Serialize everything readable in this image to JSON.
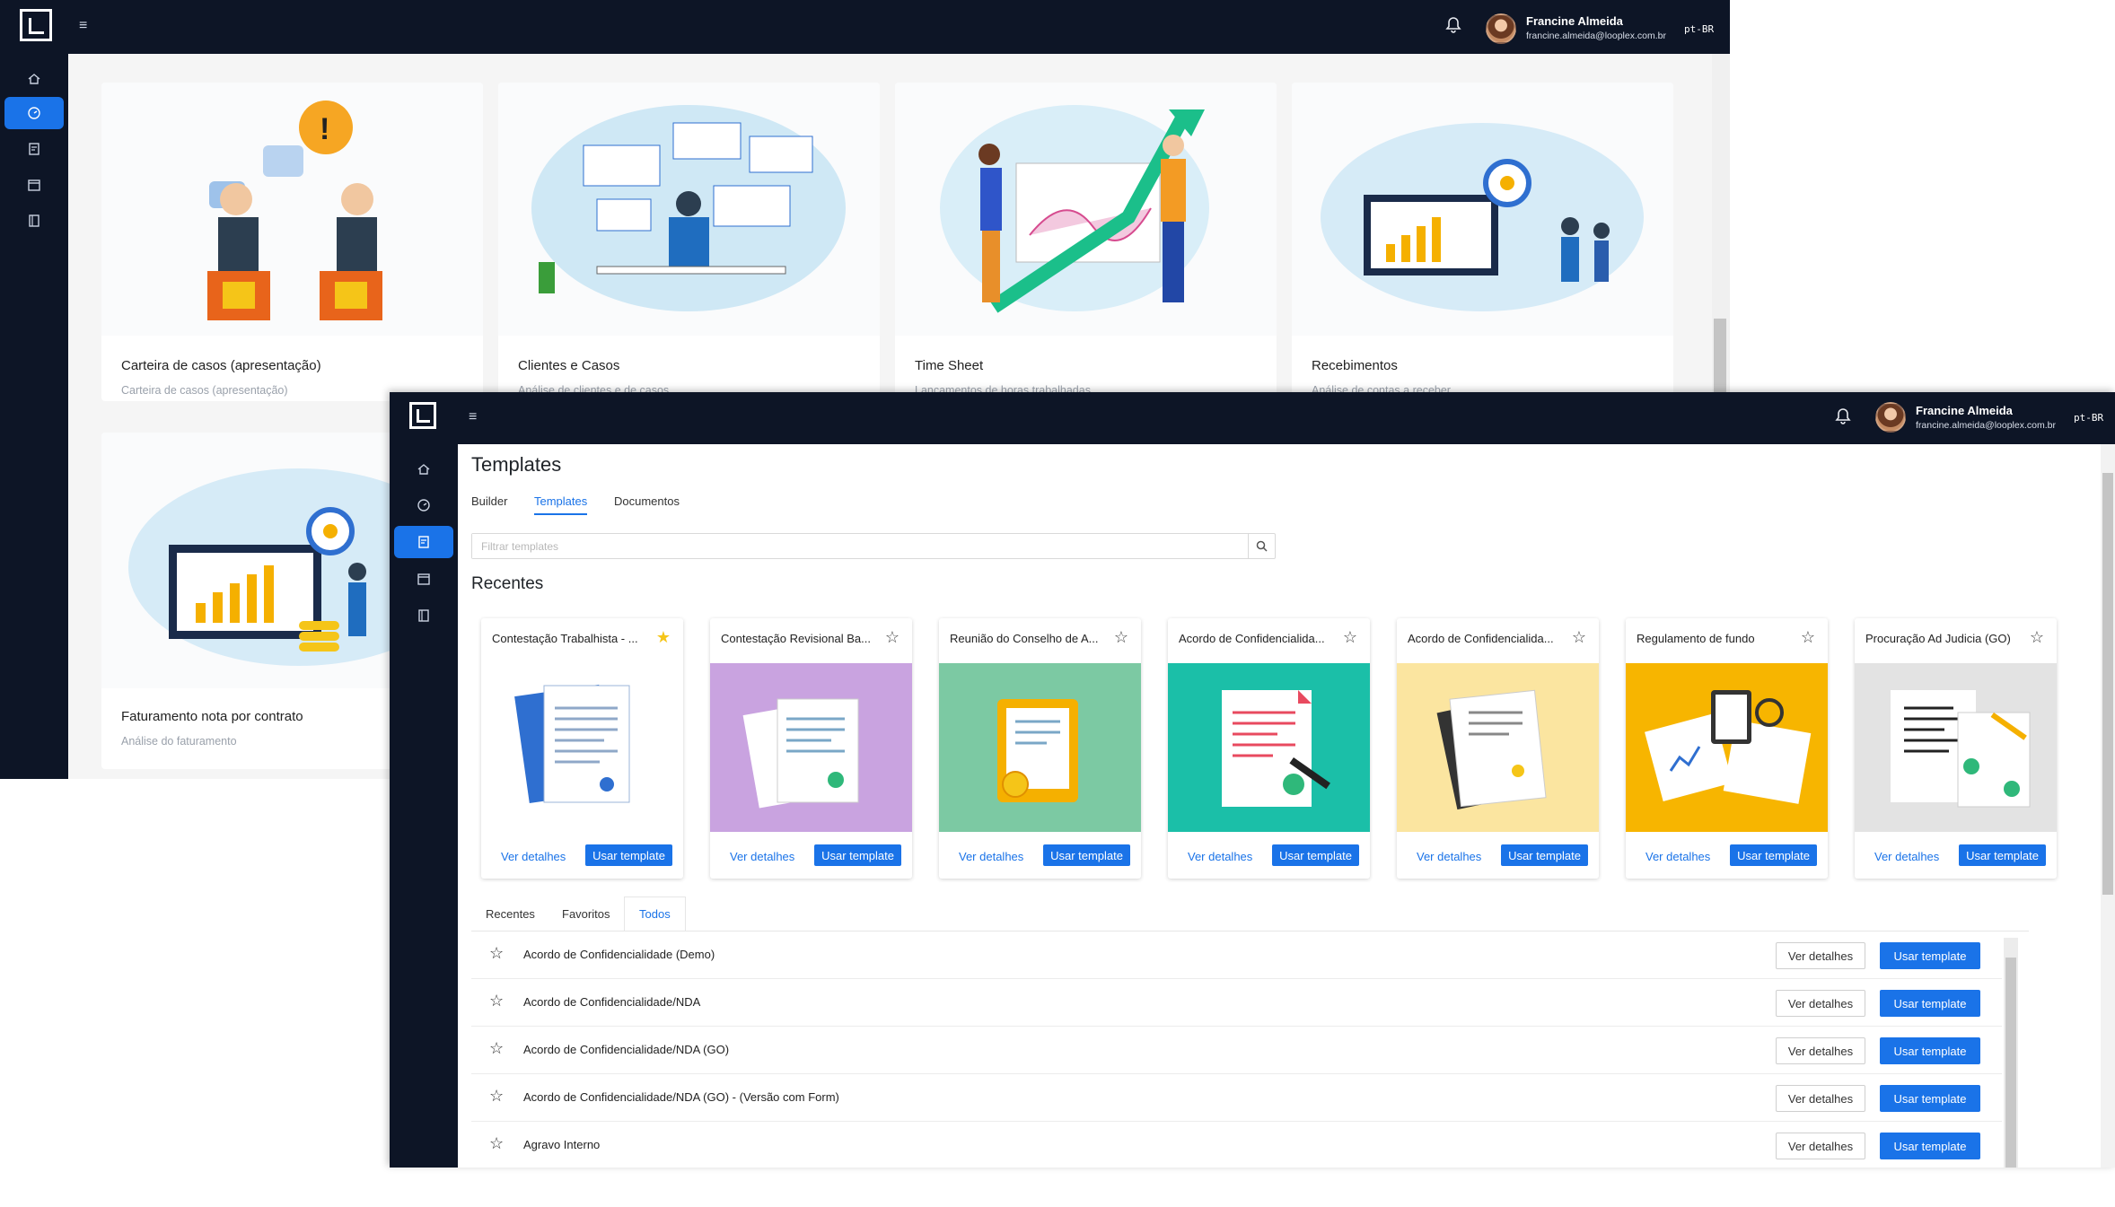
{
  "back_window": {
    "user": {
      "name": "Francine Almeida",
      "email": "francine.almeida@looplex.com.br",
      "language": "pt-BR"
    },
    "cards": [
      {
        "title": "Carteira de casos (apresentação)",
        "subtitle": "Carteira de casos (apresentação)",
        "illustration": "debate-illustration"
      },
      {
        "title": "Clientes e Casos",
        "subtitle": "Análise de clientes e de casos",
        "illustration": "dashboard-desk-illustration"
      },
      {
        "title": "Time Sheet",
        "subtitle": "Lançamentos de horas trabalhadas",
        "illustration": "growth-chart-illustration"
      },
      {
        "title": "Recebimentos",
        "subtitle": "Análise de contas a receber",
        "illustration": "monitor-target-illustration"
      },
      {
        "title": "Faturamento nota por contrato",
        "subtitle": "Análise do faturamento",
        "illustration": "monitor-coins-illustration"
      }
    ]
  },
  "front_window": {
    "user": {
      "name": "Francine Almeida",
      "email": "francine.almeida@looplex.com.br",
      "language": "pt-BR"
    },
    "page_title": "Templates",
    "tabs": [
      "Builder",
      "Templates",
      "Documentos"
    ],
    "active_tab": "Templates",
    "search": {
      "placeholder": "Filtrar templates"
    },
    "recent_heading": "Recentes",
    "recent_cards": [
      {
        "title": "Contestação Trabalhista - ...",
        "favorite": true,
        "bg": "#ffffff",
        "details": "Ver detalhes",
        "use": "Usar template"
      },
      {
        "title": "Contestação Revisional Ba...",
        "favorite": false,
        "bg": "#c9a3e0",
        "details": "Ver detalhes",
        "use": "Usar template"
      },
      {
        "title": "Reunião do Conselho de A...",
        "favorite": false,
        "bg": "#7cc9a3",
        "details": "Ver detalhes",
        "use": "Usar template"
      },
      {
        "title": "Acordo de Confidencialida...",
        "favorite": false,
        "bg": "#1bbfa8",
        "details": "Ver detalhes",
        "use": "Usar template"
      },
      {
        "title": "Acordo de Confidencialida...",
        "favorite": false,
        "bg": "#fbe5a0",
        "details": "Ver detalhes",
        "use": "Usar template"
      },
      {
        "title": "Regulamento de fundo",
        "favorite": false,
        "bg": "#f7b500",
        "details": "Ver detalhes",
        "use": "Usar template"
      },
      {
        "title": "Procuração Ad Judicia (GO)",
        "favorite": false,
        "bg": "#e3e3e3",
        "details": "Ver detalhes",
        "use": "Usar template"
      }
    ],
    "list_tabs": [
      "Recentes",
      "Favoritos",
      "Todos"
    ],
    "active_list_tab": "Todos",
    "list": [
      {
        "name": "Acordo de Confidencialidade (Demo)",
        "details": "Ver detalhes",
        "use": "Usar template"
      },
      {
        "name": "Acordo de Confidencialidade/NDA",
        "details": "Ver detalhes",
        "use": "Usar template"
      },
      {
        "name": "Acordo de Confidencialidade/NDA (GO)",
        "details": "Ver detalhes",
        "use": "Usar template"
      },
      {
        "name": "Acordo de Confidencialidade/NDA (GO) - (Versão com Form)",
        "details": "Ver detalhes",
        "use": "Usar template"
      },
      {
        "name": "Agravo Interno",
        "details": "Ver detalhes",
        "use": "Usar template"
      }
    ]
  },
  "colors": {
    "topbar": "#0d1526",
    "accent": "#1a73e8",
    "star_favorite": "#f5c518"
  },
  "icons": {
    "sidebar": [
      "home-icon",
      "dashboard-icon",
      "templates-icon",
      "calendar-icon",
      "book-icon"
    ],
    "bell": "bell-icon",
    "search": "search-icon",
    "star": "star-icon",
    "menu": "menu-icon"
  }
}
